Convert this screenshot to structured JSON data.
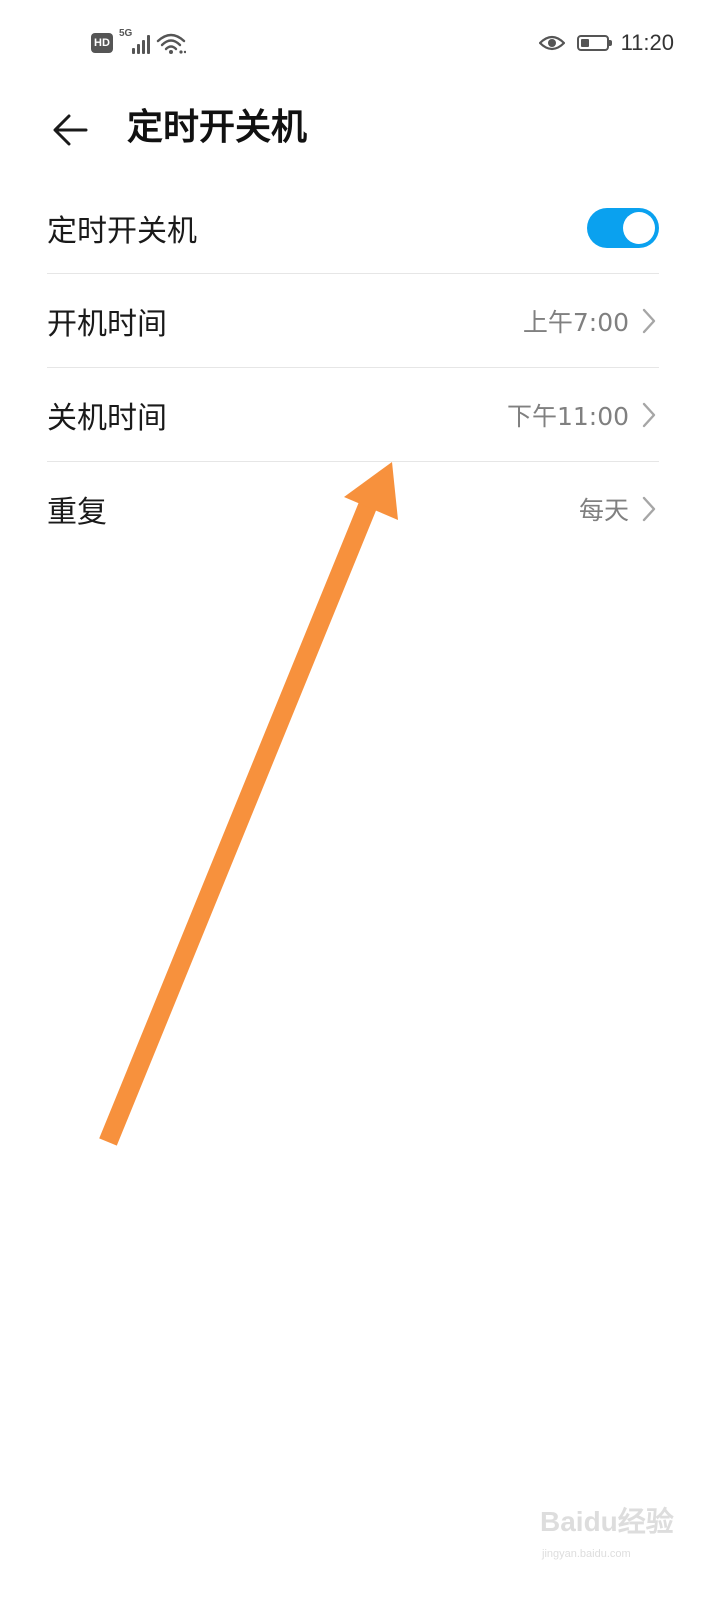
{
  "status_bar": {
    "hd_label": "HD",
    "network_label": "5G",
    "time": "11:20",
    "icons": [
      "hd-icon",
      "signal-icon",
      "wifi-icon",
      "eye-icon",
      "battery-icon"
    ],
    "battery_level": 0.3
  },
  "header": {
    "title": "定时开关机",
    "back_icon": "back-arrow-icon"
  },
  "settings": {
    "toggle_row": {
      "label": "定时开关机",
      "enabled": true
    },
    "rows": [
      {
        "label": "开机时间",
        "value": "上午7:00"
      },
      {
        "label": "关机时间",
        "value": "下午11:00"
      },
      {
        "label": "重复",
        "value": "每天"
      }
    ]
  },
  "colors": {
    "accent": "#0aa1ef",
    "annotation": "#f7913d",
    "divider": "#e6e6e6",
    "value_text": "#808080"
  },
  "watermark": {
    "text": "Baidu经验",
    "subtext": "jingyan.baidu.com"
  }
}
